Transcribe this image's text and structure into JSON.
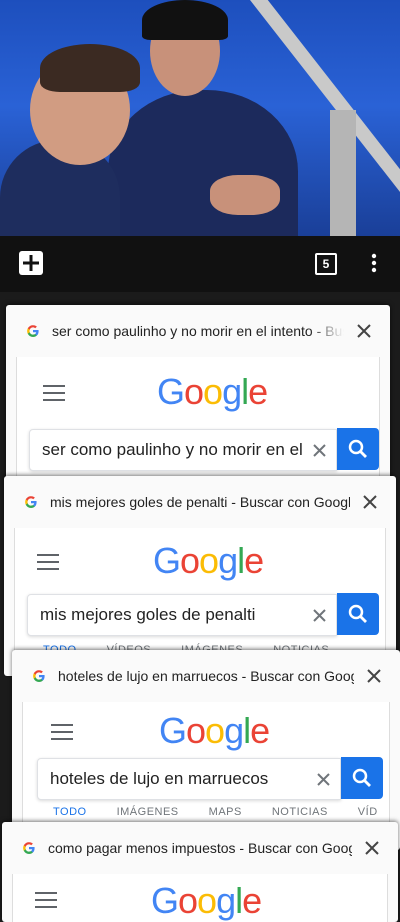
{
  "toolbar": {
    "tab_count": "5"
  },
  "tabs": [
    {
      "title": "ser como paulinho y no morir en el intento - Buscar con Google",
      "query": "ser como paulinho y no morir en el intento",
      "logo": [
        "G",
        "o",
        "o",
        "g",
        "l",
        "e"
      ]
    },
    {
      "title": "mis mejores goles de penalti - Buscar con Google",
      "query": "mis mejores goles de penalti",
      "logo": [
        "G",
        "o",
        "o",
        "g",
        "l",
        "e"
      ],
      "nav": [
        "TODO",
        "VÍDEOS",
        "IMÁGENES",
        "NOTICIAS"
      ]
    },
    {
      "title": "hoteles de lujo en marruecos - Buscar con Google",
      "query": "hoteles de lujo en marruecos",
      "logo": [
        "G",
        "o",
        "o",
        "g",
        "l",
        "e"
      ],
      "nav": [
        "TODO",
        "IMÁGENES",
        "MAPS",
        "NOTICIAS",
        "VÍD"
      ]
    },
    {
      "title": "como pagar menos impuestos - Buscar con Google",
      "logo": [
        "G",
        "o",
        "o",
        "g",
        "l",
        "e"
      ]
    }
  ],
  "colors": {
    "google_blue": "#4285f4",
    "google_red": "#ea4335",
    "google_yellow": "#fbbc05",
    "google_green": "#34a853",
    "search_button": "#1a73e8"
  }
}
